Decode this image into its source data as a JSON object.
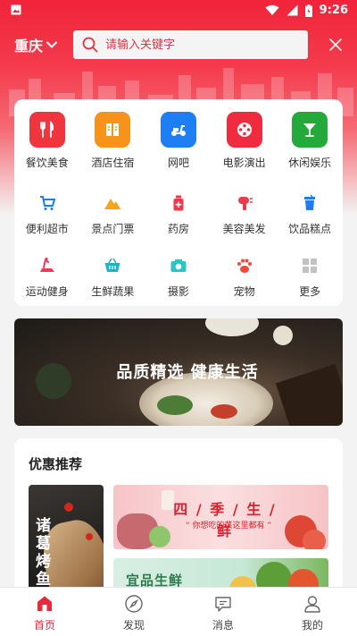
{
  "status_bar": {
    "time": "9:26"
  },
  "header": {
    "city": "重庆",
    "search": {
      "placeholder": "请输入关键字",
      "value": ""
    }
  },
  "categories": {
    "primary": [
      {
        "label": "餐饮美食",
        "icon": "fork-knife-icon",
        "color": "#f0353f"
      },
      {
        "label": "酒店住宿",
        "icon": "hotel-icon",
        "color": "#f7931a"
      },
      {
        "label": "网吧",
        "icon": "scooter-icon",
        "color": "#1f7ef2"
      },
      {
        "label": "电影演出",
        "icon": "film-reel-icon",
        "color": "#ef2b3f"
      },
      {
        "label": "休闲娱乐",
        "icon": "cocktail-icon",
        "color": "#24a93b"
      }
    ],
    "secondary": [
      {
        "label": "便利超市",
        "icon": "cart-icon",
        "color": "#1e7bf0"
      },
      {
        "label": "景点门票",
        "icon": "mountain-icon",
        "color": "#f6a41a"
      },
      {
        "label": "药房",
        "icon": "medicine-bottle-icon",
        "color": "#ef3a4a"
      },
      {
        "label": "美容美发",
        "icon": "hair-dryer-icon",
        "color": "#ef3a4a"
      },
      {
        "label": "饮品糕点",
        "icon": "drink-cup-icon",
        "color": "#1e7bf0"
      }
    ],
    "tertiary": [
      {
        "label": "运动健身",
        "icon": "treadmill-icon",
        "color": "#ef3a5a"
      },
      {
        "label": "生鲜蔬果",
        "icon": "basket-icon",
        "color": "#1fb3c9"
      },
      {
        "label": "摄影",
        "icon": "camera-icon",
        "color": "#2dc3c8"
      },
      {
        "label": "宠物",
        "icon": "paw-icon",
        "color": "#f04a3a"
      },
      {
        "label": "更多",
        "icon": "grid-icon",
        "color": "#b9b9b9"
      }
    ]
  },
  "banner": {
    "text": "品质精选 健康生活"
  },
  "recommendations": {
    "title": "优惠推荐",
    "left_card": {
      "text": "诸葛烤鱼"
    },
    "top_card": {
      "title": "四 / 季 / 生 / 鲜",
      "subtitle": "“ 你想吃的菜这里都有 ”"
    },
    "bottom_card": {
      "title": "宜品生鲜"
    }
  },
  "tabbar": {
    "items": [
      {
        "label": "首页",
        "icon": "home-icon",
        "active": true
      },
      {
        "label": "发现",
        "icon": "compass-icon",
        "active": false
      },
      {
        "label": "消息",
        "icon": "message-icon",
        "active": false
      },
      {
        "label": "我的",
        "icon": "user-icon",
        "active": false
      }
    ]
  },
  "colors": {
    "brand": "#f0233a",
    "active_tab": "#e8283c"
  }
}
